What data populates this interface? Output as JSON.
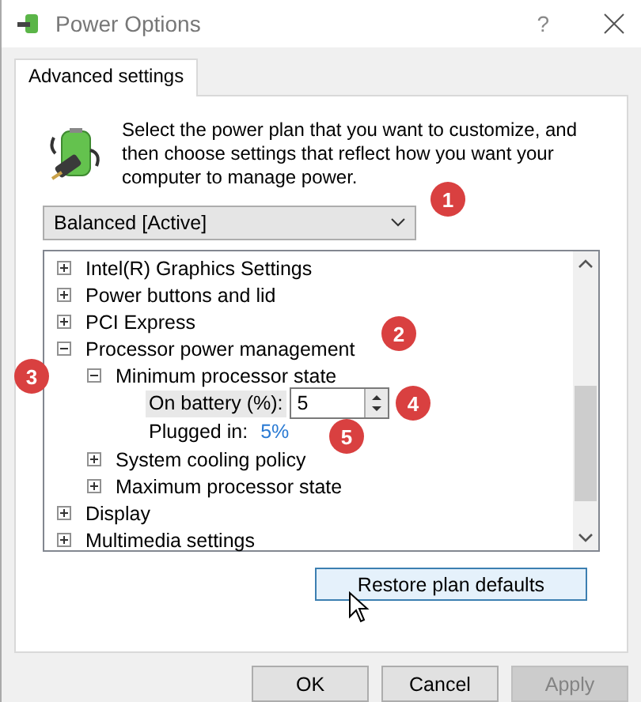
{
  "window": {
    "title": "Power Options",
    "help": "?"
  },
  "tabs": [
    {
      "label": "Advanced settings",
      "selected": true
    }
  ],
  "intro": "Select the power plan that you want to customize, and then choose settings that reflect how you want your computer to manage power.",
  "plan_dropdown": {
    "value": "Balanced [Active]",
    "callout": "1"
  },
  "tree": [
    {
      "label": "Intel(R) Graphics Settings",
      "expanded": false
    },
    {
      "label": "Power buttons and lid",
      "expanded": false
    },
    {
      "label": "PCI Express",
      "expanded": false
    },
    {
      "label": "Processor power management",
      "expanded": true,
      "callout": "2",
      "children": [
        {
          "label": "Minimum processor state",
          "expanded": true,
          "callout": "3",
          "children": [
            {
              "kind": "spinner",
              "label": "On battery (%):",
              "value": "5",
              "selected": true,
              "callout": "4"
            },
            {
              "kind": "value",
              "label": "Plugged in:",
              "value": "5%",
              "selected": false,
              "callout": "5"
            }
          ]
        },
        {
          "label": "System cooling policy",
          "expanded": false
        },
        {
          "label": "Maximum processor state",
          "expanded": false
        }
      ]
    },
    {
      "label": "Display",
      "expanded": false
    },
    {
      "label": "Multimedia settings",
      "expanded": false
    }
  ],
  "restore_button": "Restore plan defaults",
  "buttons": [
    {
      "label": "OK",
      "disabled": false
    },
    {
      "label": "Cancel",
      "disabled": false
    },
    {
      "label": "Apply",
      "disabled": true
    }
  ]
}
